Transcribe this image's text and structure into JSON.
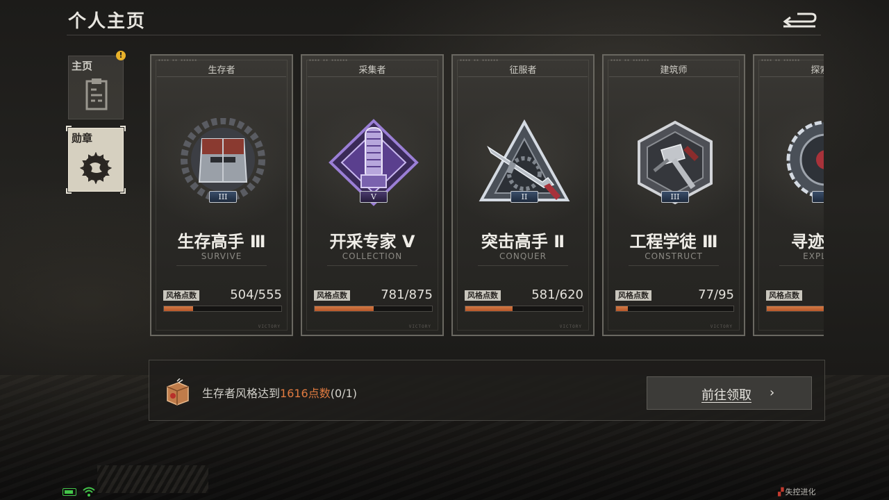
{
  "header": {
    "title": "个人主页"
  },
  "side_tabs": [
    {
      "label": "主页",
      "active": false,
      "icon": "clipboard-icon",
      "has_notice": true,
      "notice": "!"
    },
    {
      "label": "勋章",
      "active": true,
      "icon": "emblem-icon"
    }
  ],
  "cards": [
    {
      "tag": "生存者",
      "name": "生存高手 Ⅲ",
      "en": "SURVIVE",
      "tier": "III",
      "style_label": "风格点数",
      "value": "504/555",
      "progress": 0.25,
      "badge": "helmet-badge-icon"
    },
    {
      "tag": "采集者",
      "name": "开采专家 V",
      "en": "COLLECTION",
      "tier": "V",
      "style_label": "风格点数",
      "value": "781/875",
      "progress": 0.5,
      "badge": "chainsaw-badge-icon"
    },
    {
      "tag": "征服者",
      "name": "突击高手 Ⅱ",
      "en": "CONQUER",
      "tier": "II",
      "style_label": "风格点数",
      "value": "581/620",
      "progress": 0.4,
      "badge": "rifle-badge-icon"
    },
    {
      "tag": "建筑师",
      "name": "工程学徒 Ⅲ",
      "en": "CONSTRUCT",
      "tier": "III",
      "style_label": "风格点数",
      "value": "77/95",
      "progress": 0.1,
      "badge": "hammer-badge-icon"
    },
    {
      "tag": "探索者",
      "name": "寻迹高手",
      "en": "EXPLORE",
      "tier": "I",
      "style_label": "风格点数",
      "value": "",
      "progress": 0.6,
      "badge": "compass-badge-icon"
    }
  ],
  "quest": {
    "prefix": "生存者风格达到",
    "highlight": "1616点数",
    "suffix": "(0/1)",
    "button_label": "前往领取",
    "button_arrow": "›"
  },
  "card_footer": "VICTORY",
  "watermark": {
    "mark": "▞",
    "text": "失控进化"
  },
  "colors": {
    "accent": "#e07a40",
    "progress": "#c8653a",
    "notice": "#e8b12a",
    "battery": "#43c64a"
  }
}
